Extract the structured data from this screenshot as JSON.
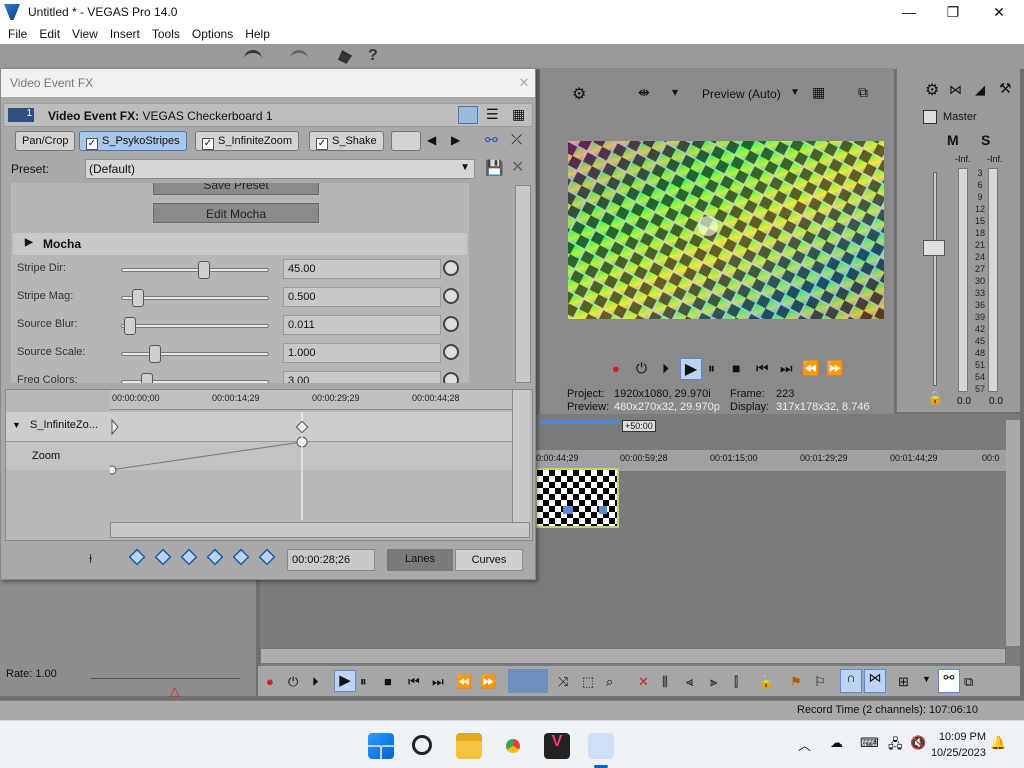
{
  "window": {
    "title": "Untitled * - VEGAS Pro 14.0",
    "minimize": "—",
    "maximize": "❐",
    "close": "✕"
  },
  "menu": [
    "File",
    "Edit",
    "View",
    "Insert",
    "Tools",
    "Options",
    "Help"
  ],
  "fx": {
    "window_title": "Video Event FX",
    "close": "✕",
    "index": "1",
    "header_bold": "Video Event FX:",
    "header_name": "VEGAS Checkerboard 1",
    "chain": [
      {
        "label": "Pan/Crop",
        "check": false
      },
      {
        "label": "S_PsykoStripes",
        "check": true
      },
      {
        "label": "S_InfiniteZoom",
        "check": true
      },
      {
        "label": "S_Shake",
        "check": true
      }
    ],
    "preset_label": "Preset:",
    "preset_value": "(Default)",
    "save_preset": "Save Preset",
    "edit_mocha": "Edit Mocha",
    "mocha": "Mocha",
    "params": [
      {
        "label": "Stripe Dir:",
        "value": "45.00",
        "level": 0.55
      },
      {
        "label": "Stripe Mag:",
        "value": "0.500",
        "level": 0.08
      },
      {
        "label": "Source Blur:",
        "value": "0.011",
        "level": 0.02
      },
      {
        "label": "Source Scale:",
        "value": "1.000",
        "level": 0.2
      },
      {
        "label": "Freq Colors:",
        "value": "3.00",
        "level": 0.14
      }
    ],
    "ruler_ticks": [
      "00:00:00;00",
      "00:00:14;29",
      "00:00:29;29",
      "00:00:44;28"
    ],
    "track_name": "S_InfiniteZo...",
    "zoom_label": "Zoom",
    "time_field": "00:00:28;26",
    "lanes": "Lanes",
    "curves": "Curves"
  },
  "preview": {
    "mode": "Preview (Auto)",
    "project_label": "Project:",
    "project_value": "1920x1080, 29.970i",
    "preview_label": "Preview:",
    "preview_value": "480x270x32, 29.970p",
    "frame_label": "Frame:",
    "frame_value": "223",
    "display_label": "Display:",
    "display_value": "317x178x32, 8.746"
  },
  "master": {
    "title": "Master",
    "m": "M",
    "s": "S",
    "inf_left": "-Inf.",
    "inf_right": "-Inf.",
    "scale": [
      "3",
      "6",
      "9",
      "12",
      "15",
      "18",
      "21",
      "24",
      "27",
      "30",
      "33",
      "36",
      "39",
      "42",
      "45",
      "48",
      "51",
      "54",
      "57"
    ],
    "bottom_left": "0.0",
    "bottom_right": "0.0"
  },
  "timeline": {
    "offset_badge": "+50:00",
    "ticks": [
      "0:00:44;29",
      "00:00:59;28",
      "00:01:15;00",
      "00:01:29;29",
      "00:01:44;29",
      "00:0"
    ]
  },
  "rate": "Rate: 1.00",
  "status": "Record Time (2 channels): 107:06:10",
  "taskbar": {
    "time": "10:09 PM",
    "date": "10/25/2023",
    "chevron": "︿"
  },
  "colors": {
    "accent": "#1f5aa8",
    "clip_border": "#b8d86a",
    "window_bg": "#a9a9a9"
  }
}
